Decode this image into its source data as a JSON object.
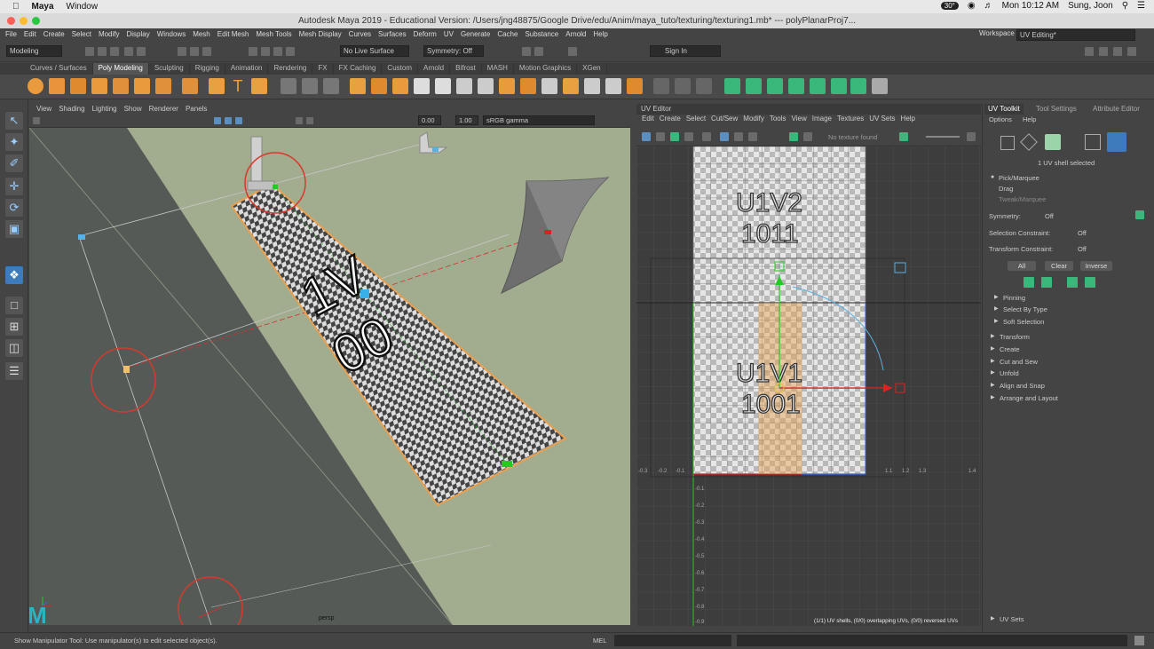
{
  "mac_menu": {
    "app": "Maya",
    "window": "Window",
    "clock": "Mon 10:12 AM",
    "user": "Sung, Joon",
    "temp": "30°"
  },
  "window_title": "Autodesk Maya 2019 - Educational Version: /Users/jng48875/Google Drive/edu/Anim/maya_tuto/texturing/texturing1.mb*  ---  polyPlanarProj7...",
  "main_menu": [
    "File",
    "Edit",
    "Create",
    "Select",
    "Modify",
    "Display",
    "Windows",
    "Mesh",
    "Edit Mesh",
    "Mesh Tools",
    "Mesh Display",
    "Curves",
    "Surfaces",
    "Deform",
    "UV",
    "Generate",
    "Cache",
    "Substance",
    "Arnold",
    "Help"
  ],
  "workspace": {
    "label": "Workspace :",
    "value": "UV Editing*"
  },
  "status_line": {
    "menuset": "Modeling",
    "live_surface": "No Live Surface",
    "symmetry": "Symmetry: Off",
    "sign_in": "Sign In"
  },
  "shelf_tabs": [
    "Curves / Surfaces",
    "Poly Modeling",
    "Sculpting",
    "Rigging",
    "Animation",
    "Rendering",
    "FX",
    "FX Caching",
    "Custom",
    "Arnold",
    "Bifrost",
    "MASH",
    "Motion Graphics",
    "XGen"
  ],
  "shelf_active": "Poly Modeling",
  "viewport": {
    "menu": [
      "View",
      "Shading",
      "Lighting",
      "Show",
      "Renderer",
      "Panels"
    ],
    "field1": "0.00",
    "field2": "1.00",
    "colorspace": "sRGB gamma",
    "camera_label": "persp",
    "plane_text_line1": "1V",
    "plane_text_line2": "00"
  },
  "uv_editor": {
    "title": "UV Editor",
    "menu": [
      "Edit",
      "Create",
      "Select",
      "Cut/Sew",
      "Modify",
      "Tools",
      "View",
      "Image",
      "Textures",
      "UV Sets",
      "Help"
    ],
    "no_texture": "No texture found",
    "tile_top_line1": "U1V2",
    "tile_top_line2": "1011",
    "tile_bottom_line1": "U1V1",
    "tile_bottom_line2": "1001",
    "status": "(1/1) UV shells, (0/0) overlapping UVs, (0/0) reversed UVs",
    "ruler_labels_x": [
      "-0.3",
      "-0.2",
      "-0.1",
      "1.1",
      "1.2",
      "1.3",
      "1.4"
    ],
    "ruler_labels_y": [
      "-0.1",
      "-0.2",
      "-0.3",
      "-0.4",
      "-0.5",
      "-0.6",
      "-0.7",
      "-0.8",
      "-0.9"
    ]
  },
  "uv_toolkit": {
    "tabs": [
      "UV Toolkit",
      "Tool Settings",
      "Attribute Editor"
    ],
    "submenu": [
      "Options",
      "Help"
    ],
    "selection_status": "1 UV shell selected",
    "modes": [
      "Pick/Marquee",
      "Drag",
      "Tweak/Marquee"
    ],
    "symmetry_label": "Symmetry:",
    "symmetry_value": "Off",
    "selection_constraint_label": "Selection Constraint:",
    "selection_constraint_value": "Off",
    "transform_constraint_label": "Transform Constraint:",
    "transform_constraint_value": "Off",
    "buttons": [
      "All",
      "Clear",
      "Inverse"
    ],
    "subsections": [
      "Pinning",
      "Select By Type",
      "Soft Selection"
    ],
    "sections": [
      "Transform",
      "Create",
      "Cut and Sew",
      "Unfold",
      "Align and Snap",
      "Arrange and Layout"
    ],
    "uv_sets": "UV Sets"
  },
  "help_line": "Show Manipulator Tool: Use manipulator(s) to edit selected object(s).",
  "command_lang": "MEL",
  "colors": {
    "accent_orange": "#e8a050",
    "annotation_red": "#d63a2a",
    "manip_blue": "#5ab0e0",
    "manip_green": "#22cc22",
    "manip_red": "#e02020"
  }
}
